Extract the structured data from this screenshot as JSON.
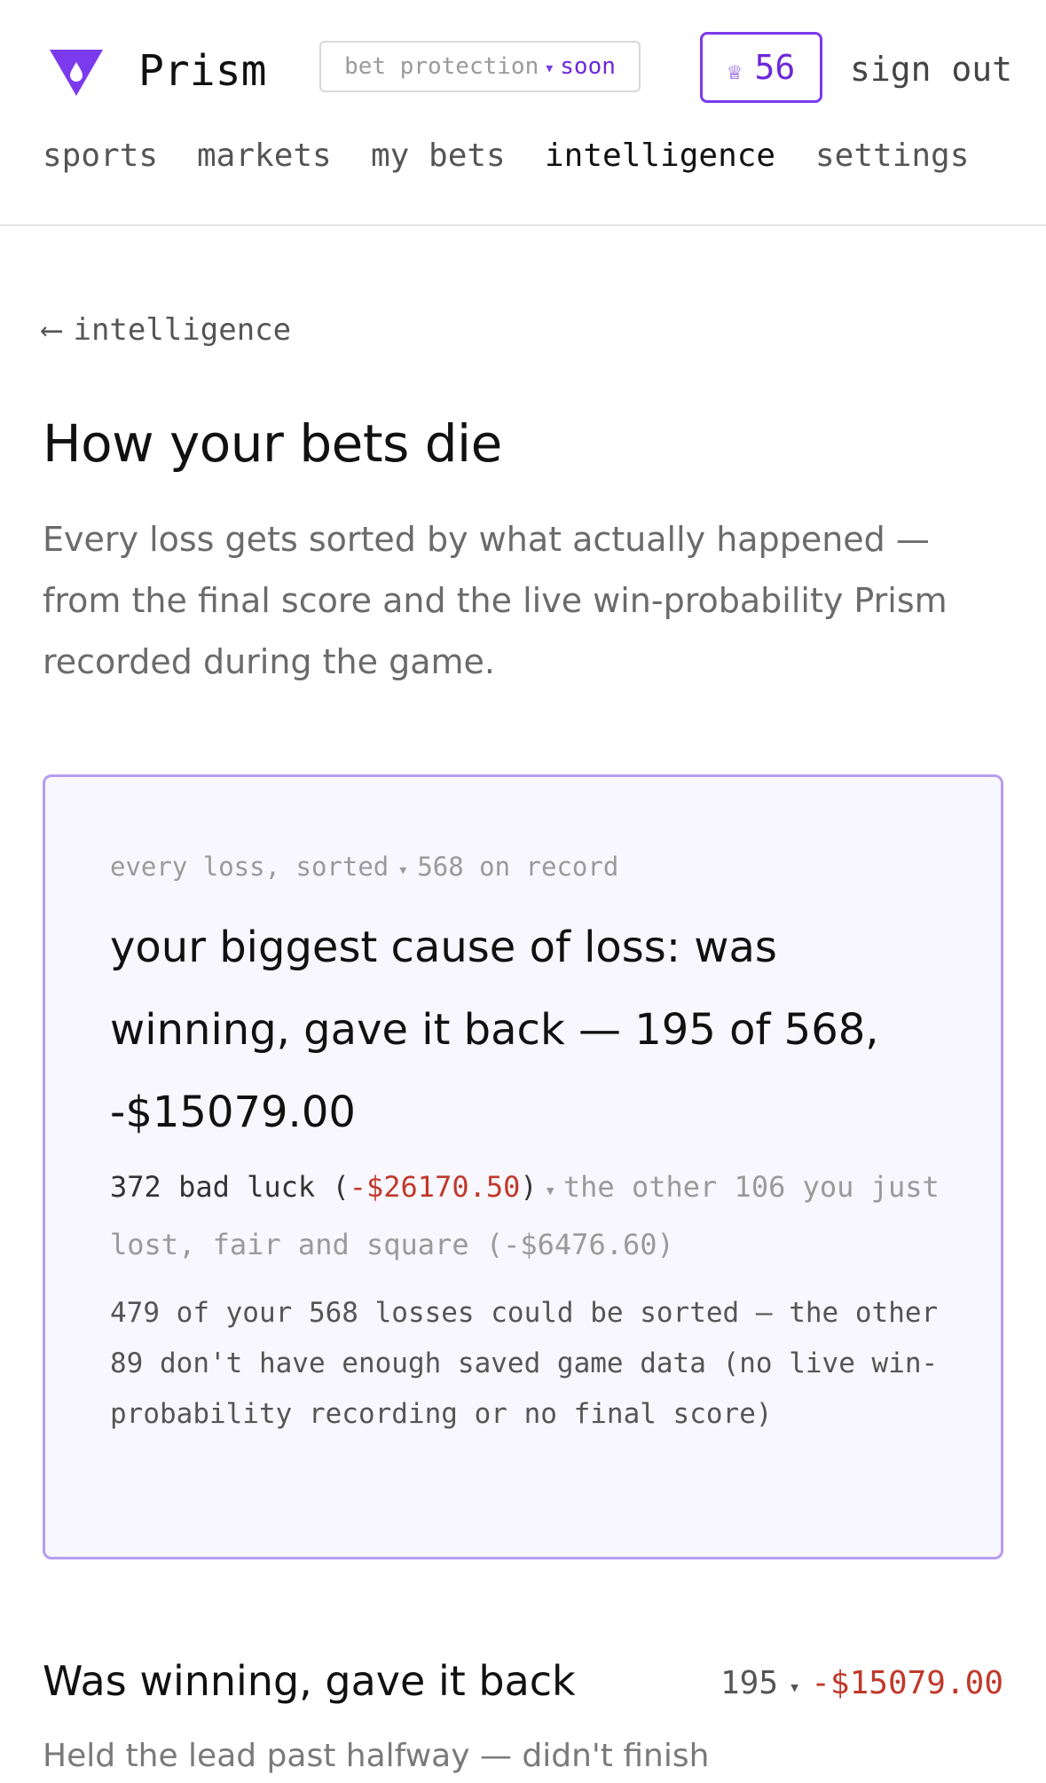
{
  "header": {
    "brand": "Prism",
    "bet_protection": {
      "label": "bet protection",
      "separator": "▾",
      "status": "soon"
    },
    "crown": {
      "icon": "♕",
      "count": "56"
    },
    "sign_out": "sign out",
    "nav": [
      "sports",
      "markets",
      "my bets",
      "intelligence",
      "settings"
    ],
    "active_tab": "intelligence"
  },
  "back": {
    "arrow": "⟵",
    "label": "intelligence"
  },
  "page": {
    "title": "How your bets die",
    "lead": "Every loss gets sorted by what actually happened — from the final score and the live win-probability Prism recorded during the game."
  },
  "summary_card": {
    "label_left": "every loss, sorted",
    "label_sep": "▾",
    "label_right": "568 on record",
    "headline": "your biggest cause of loss: was winning, gave it back — 195 of 568, -$15079.00",
    "bad_luck_count": "372 bad luck (",
    "bad_luck_amount": "-$26170.50",
    "bad_luck_close": ")",
    "sep": "▾",
    "other_text": "the other 106 you just lost, fair and square (-$6476.60)",
    "note": "479 of your 568 losses could be sorted — the other 89 don't have enough saved game data (no live win-probability recording or no final score)"
  },
  "category": {
    "title": "Was winning, gave it back",
    "count": "195",
    "sep": "▾",
    "amount": "-$15079.00",
    "description": "Held the lead past halfway — didn't finish"
  },
  "colors": {
    "accent": "#7c3aed",
    "loss": "#c0392b",
    "card_bg": "#f8f7fd",
    "card_border": "#b79cf0"
  }
}
